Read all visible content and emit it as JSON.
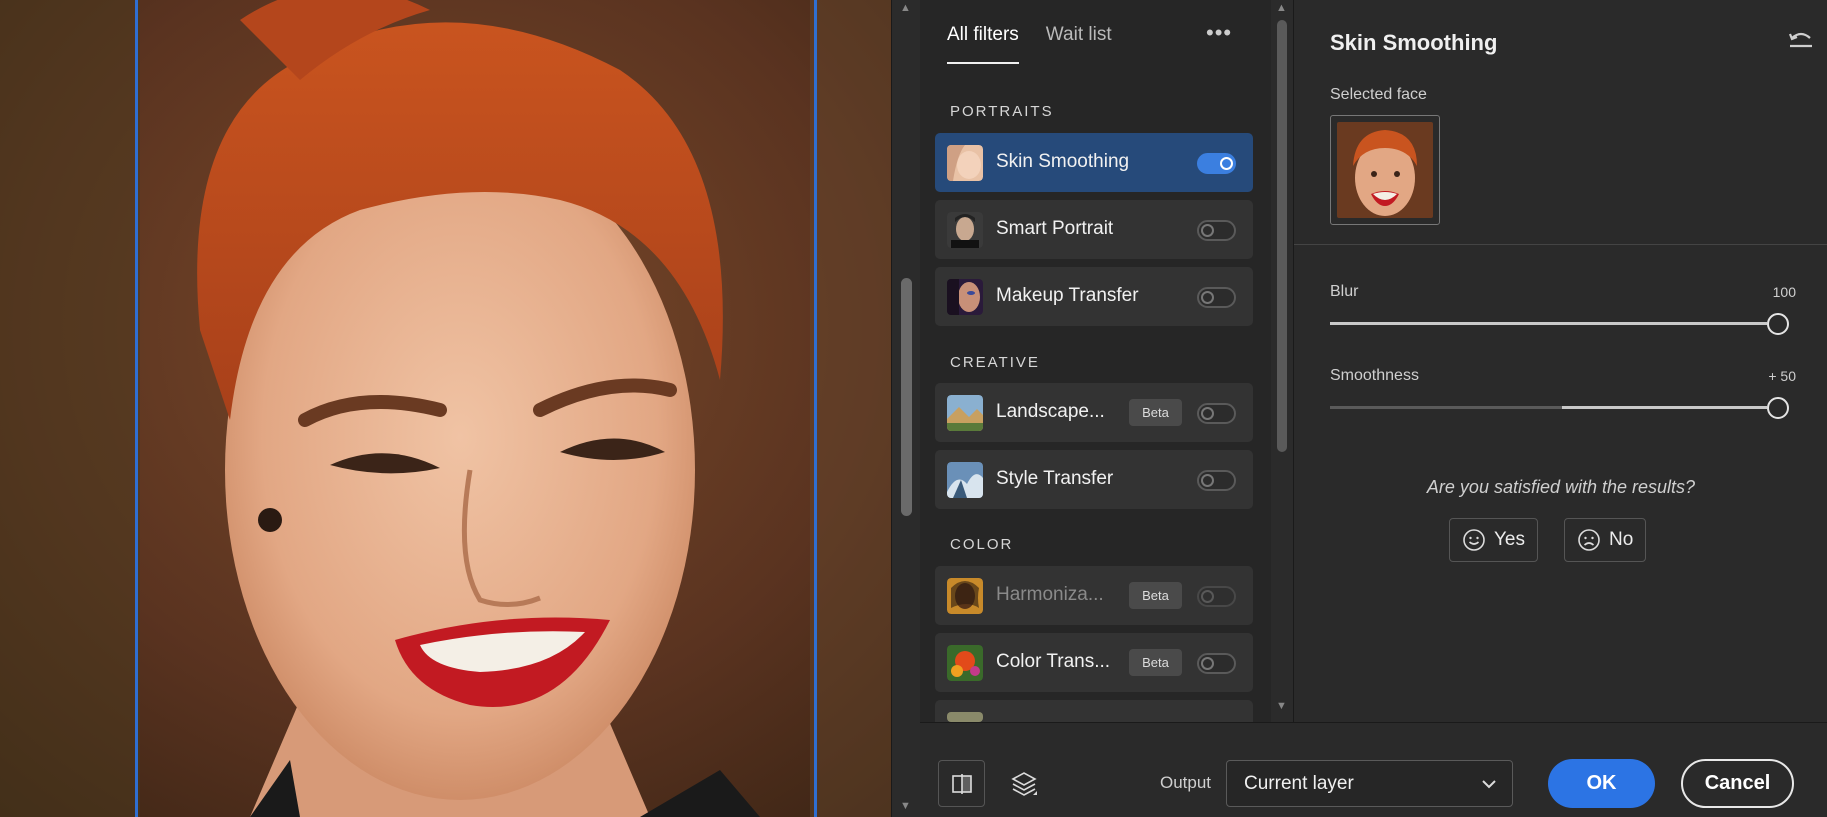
{
  "canvas": {
    "image_description_icon": "portrait-photo"
  },
  "filters": {
    "tabs": [
      {
        "label": "All filters",
        "active": true
      },
      {
        "label": "Wait list",
        "active": false
      }
    ],
    "more_icon": "more-horizontal-icon",
    "sections": [
      {
        "title": "PORTRAITS"
      },
      {
        "title": "CREATIVE"
      },
      {
        "title": "COLOR"
      }
    ],
    "items": [
      {
        "label": "Skin Smoothing",
        "enabled": true,
        "selected": true,
        "badge": ""
      },
      {
        "label": "Smart Portrait",
        "enabled": false,
        "selected": false,
        "badge": ""
      },
      {
        "label": "Makeup Transfer",
        "enabled": false,
        "selected": false,
        "badge": ""
      },
      {
        "label": "Landscape...",
        "enabled": false,
        "selected": false,
        "badge": "Beta"
      },
      {
        "label": "Style Transfer",
        "enabled": false,
        "selected": false,
        "badge": ""
      },
      {
        "label": "Harmoniza...",
        "enabled": false,
        "selected": false,
        "badge": "Beta",
        "dimmed": true
      },
      {
        "label": "Color Trans...",
        "enabled": false,
        "selected": false,
        "badge": "Beta"
      }
    ]
  },
  "properties": {
    "title": "Skin Smoothing",
    "selected_face_label": "Selected face",
    "sliders": [
      {
        "label": "Blur",
        "value_text": "100",
        "level": 1.0
      },
      {
        "label": "Smoothness",
        "value_text": "+ 50",
        "level": 1.0
      }
    ],
    "feedback": {
      "question": "Are you satisfied with the results?",
      "yes_label": "Yes",
      "no_label": "No"
    }
  },
  "bottom": {
    "output_label": "Output",
    "output_value": "Current layer",
    "ok_label": "OK",
    "cancel_label": "Cancel"
  },
  "colors": {
    "accent": "#2c74e4",
    "selected_item": "#264a7a",
    "guide": "#2f6fd1"
  }
}
